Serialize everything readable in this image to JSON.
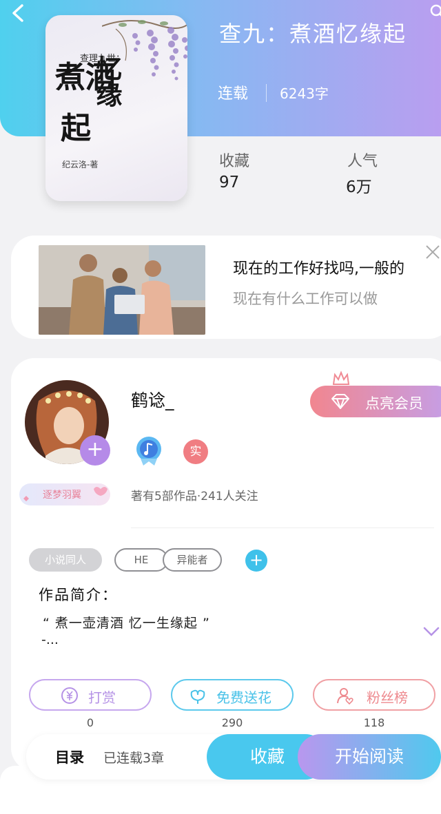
{
  "header": {
    "book_title": "查九：煮酒忆缘起",
    "status": "连载",
    "word_count": "6243字"
  },
  "cover": {
    "small_title": "查理九世：",
    "calligraphy": [
      "煮酒",
      "忆缘",
      "起"
    ],
    "author": "纪云洛-著"
  },
  "stats": {
    "favorites_label": "收藏",
    "favorites_value": "97",
    "popularity_label": "人气",
    "popularity_value": "6万"
  },
  "ad": {
    "title": "现在的工作好找吗,一般的",
    "subtitle": "现在有什么工作可以做"
  },
  "profile": {
    "username": "鹤谂_",
    "badge": "逐梦羽翼",
    "vip_label": "点亮会员",
    "real_badge": "实",
    "works_info": "著有5部作品·241人关注"
  },
  "tags": [
    "小说同人",
    "HE",
    "异能者"
  ],
  "intro": {
    "title": "作品简介：",
    "text": "“ 煮一壶清酒 忆一生缘起 ”",
    "more": "-..."
  },
  "actions": [
    {
      "label": "打赏",
      "count": "0",
      "color": "#b592e6"
    },
    {
      "label": "免费送花",
      "count": "290",
      "color": "#49c2e8"
    },
    {
      "label": "粉丝榜",
      "count": "118",
      "color": "#ee8a8f"
    }
  ],
  "bottom": {
    "toc_label": "目录",
    "toc_sub": "已连载3章",
    "favorite_button": "收藏",
    "read_button": "开始阅读"
  }
}
